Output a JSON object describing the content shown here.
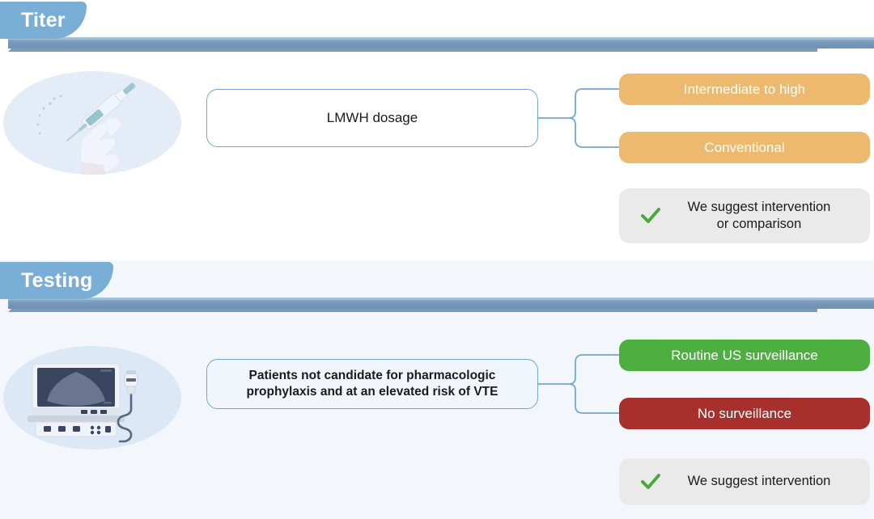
{
  "sections": [
    {
      "id": "titer",
      "header": "Titer",
      "illustration": "syringe-in-gloved-hand-illustration",
      "node": "LMWH dosage",
      "options": [
        {
          "label": "Intermediate to high",
          "color": "#ECB96F"
        },
        {
          "label": "Conventional",
          "color": "#ECB96F"
        }
      ],
      "suggestion": {
        "icon": "green-check-icon",
        "icon_color": "#4CA83C",
        "line1": "We suggest intervention",
        "line2": "or comparison"
      }
    },
    {
      "id": "testing",
      "header": "Testing",
      "illustration": "ultrasound-machine-illustration",
      "node": "Patients not candidate for pharmacologic prophylaxis and at an elevated risk of VTE",
      "options": [
        {
          "label": "Routine US surveillance",
          "color": "#4CAF3F"
        },
        {
          "label": "No surveillance",
          "color": "#A8302C"
        }
      ],
      "suggestion": {
        "icon": "green-check-icon",
        "icon_color": "#4CA83C",
        "line1": "We suggest intervention",
        "line2": ""
      }
    }
  ],
  "theme": {
    "tab_blue": "#79AED6",
    "ribbon_blue": "#7497B8",
    "connector_blue": "#6FA8D4",
    "suggest_gray": "#EAEAEA",
    "testing_bg": "#F3F7FC"
  }
}
